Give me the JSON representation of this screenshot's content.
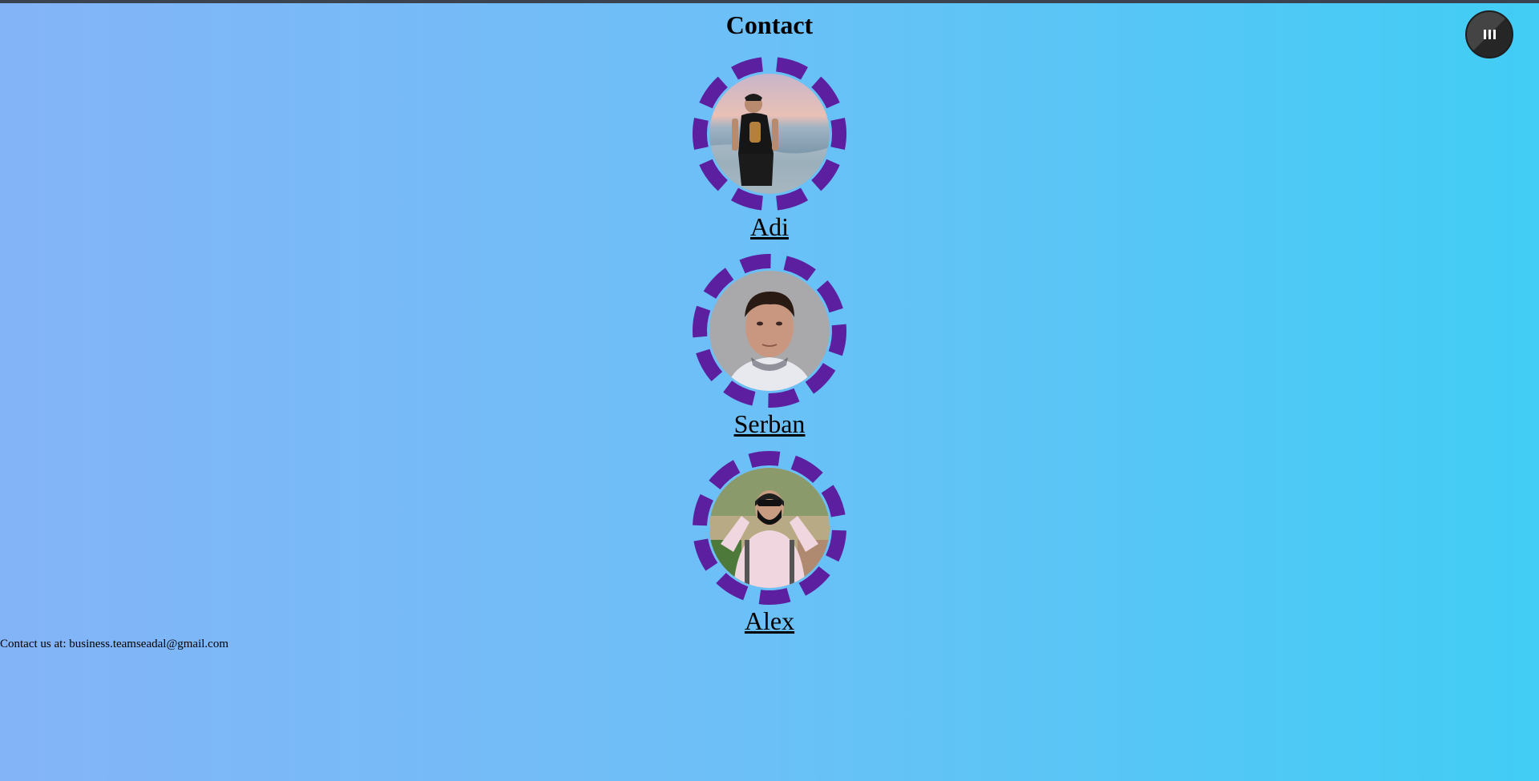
{
  "page": {
    "title": "Contact",
    "menu_icon": "pause-bars-icon"
  },
  "members": [
    {
      "name": "Adi",
      "photo": "photo of man standing on beach"
    },
    {
      "name": "Serban",
      "photo": "portrait photo of young man"
    },
    {
      "name": "Alex",
      "photo": "photo of man in pink shirt wearing mask and sunglasses"
    }
  ],
  "footer": {
    "text": "Contact us at: business.teamseadal@gmail.com"
  },
  "colors": {
    "ring": "#5b1fa0",
    "bg_left": "#84b4f8",
    "bg_right": "#41cdf5"
  }
}
